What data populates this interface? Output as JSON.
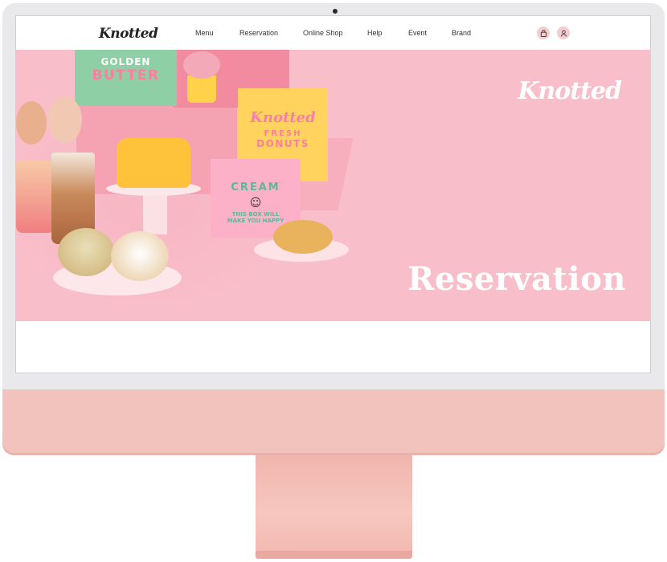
{
  "brand": {
    "logo_text": "Knotted"
  },
  "nav": {
    "items": [
      {
        "label": "Menu"
      },
      {
        "label": "Reservation"
      },
      {
        "label": "Online Shop"
      },
      {
        "label": "Help"
      },
      {
        "label": "Event"
      },
      {
        "label": "Brand"
      }
    ],
    "cart_icon": "shopping-bag-icon",
    "account_icon": "user-icon"
  },
  "hero": {
    "logo_text": "Knotted",
    "title": "Reservation",
    "boxes": {
      "golden_line1": "GOLDEN",
      "golden_line2": "BUTTER",
      "donuts_brand": "Knotted",
      "donuts_line1": "FRESH",
      "donuts_line2": "DONUTS",
      "cream_line1": "CREAM",
      "cream_line2": "THIS BOX WILL",
      "cream_line3": "MAKE YOU HAPPY"
    }
  },
  "colors": {
    "hero_bg": "#f8bfca",
    "device_chin": "#f2c3bd",
    "device_stand": "#f0b5ad",
    "icon_bg": "#f4cdd0"
  }
}
